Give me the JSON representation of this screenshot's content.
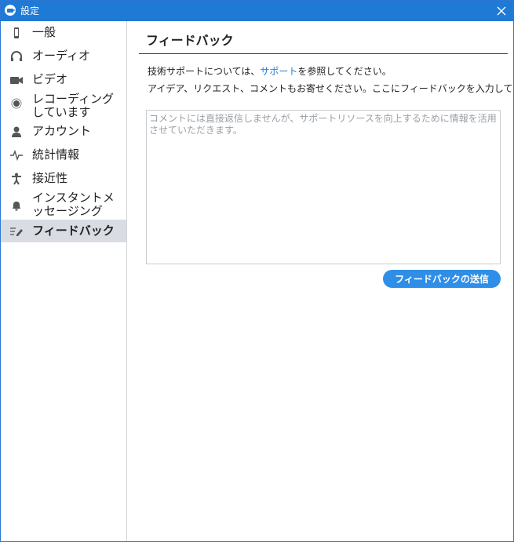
{
  "window": {
    "title": "設定",
    "close_icon": "close-icon"
  },
  "sidebar": {
    "items": [
      {
        "label": "一般",
        "icon": "phone-icon",
        "active": false
      },
      {
        "label": "オーディオ",
        "icon": "headphones-icon",
        "active": false
      },
      {
        "label": "ビデオ",
        "icon": "video-camera-icon",
        "active": false
      },
      {
        "label": "レコーディングしています",
        "icon": "record-icon",
        "active": false
      },
      {
        "label": "アカウント",
        "icon": "person-icon",
        "active": false
      },
      {
        "label": "統計情報",
        "icon": "pulse-icon",
        "active": false
      },
      {
        "label": "接近性",
        "icon": "accessibility-icon",
        "active": false
      },
      {
        "label": "インスタントメッセージング",
        "icon": "bell-icon",
        "active": false
      },
      {
        "label": "フィードバック",
        "icon": "pencil-lines-icon",
        "active": true
      }
    ]
  },
  "main": {
    "title": "フィードバック",
    "line1_prefix": "技術サポートについては、",
    "line1_link": "サポート",
    "line1_suffix": "を参照してください。",
    "line2": "アイデア、リクエスト、コメントもお寄せください。ここにフィードバックを入力してください:",
    "comment_placeholder": "コメントには直接返信しませんが、サポートリソースを向上するために情報を活用させていただきます。",
    "submit_label": "フィードバックの送信"
  },
  "colors": {
    "titlebar": "#1f7ad6",
    "active_item_bg": "#d9dde3",
    "link": "#2b7cd3",
    "button": "#2e8ee8"
  }
}
